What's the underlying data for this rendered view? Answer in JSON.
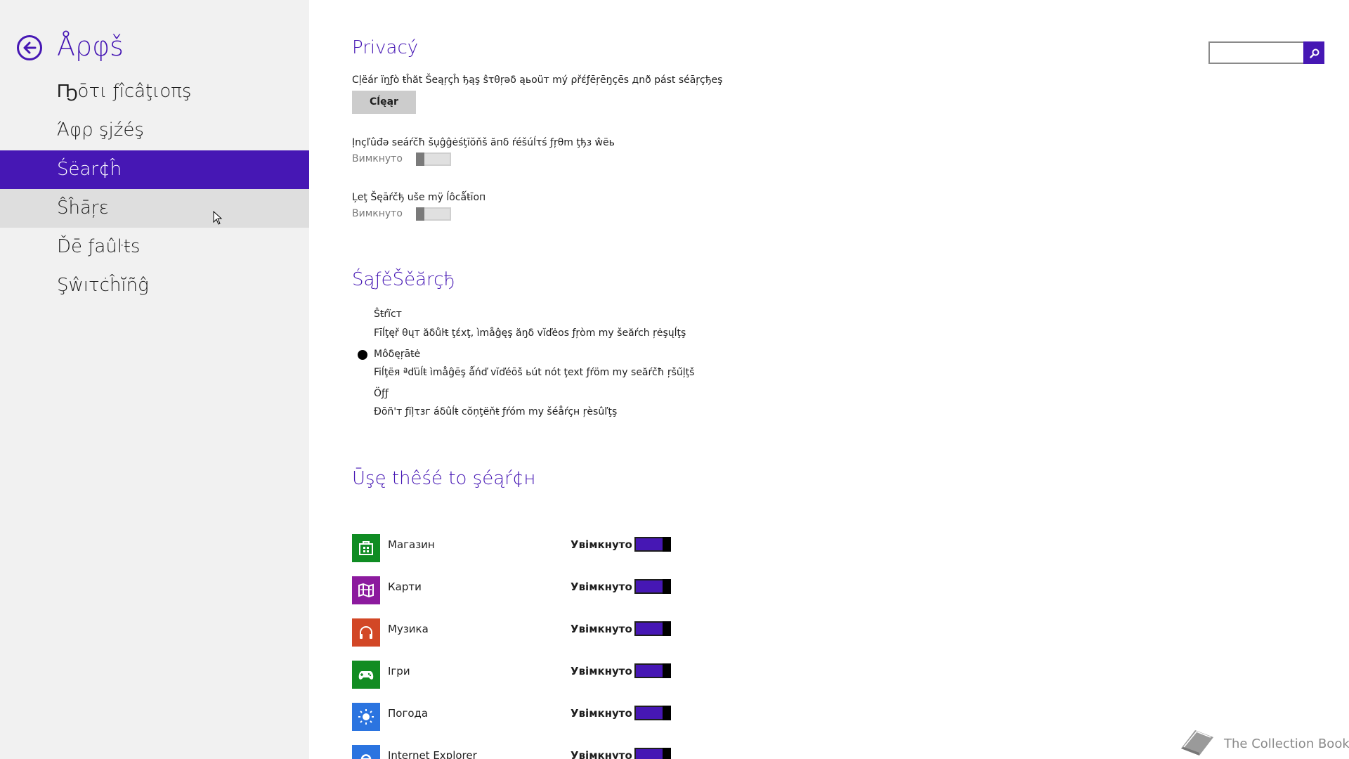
{
  "app_header": {
    "title": "Åρφš"
  },
  "nav": {
    "items": [
      {
        "label": "Ҧōτι ƒîcâţιoπş"
      },
      {
        "label": "Άφρ şjźéş"
      },
      {
        "label": "Śëar¢ĥ"
      },
      {
        "label": "Ŝĥāŗɛ"
      },
      {
        "label": "Ďē ƒaûŀŧs"
      },
      {
        "label": "Şŵıτċĥĭñĝ"
      }
    ]
  },
  "search": {
    "placeholder": "",
    "button_icon": "magnifier-icon"
  },
  "privacy": {
    "heading": "Privacý",
    "clear_desc": "Cļëár ïŋƒò ŧĥăt Šeąŗçĥ ђąş ŝτθŗəδ ąьoüт mý ρřέƒēŗēŋçēs дnð pást séāŗçђeş",
    "clear_label": "Cĺęąr",
    "suggestions_label": "Ịnçľûđə seáŕčħ šụĝĝėśţīŏňš ăпδ ŕéšúĺτś ƒŗθm ţђз ŵëь",
    "suggestions_state": "Вимкнуто",
    "location_label": "Ļeţ Šęāŕčђ uše mÿ ĺôcǻŧīoп",
    "location_state": "Вимкнуто"
  },
  "safesearch": {
    "heading": "ŚąƒěŠěărçђ",
    "options": [
      {
        "label": "Ŝŧŕïст",
        "desc": "Fīĺţęř θųт ăδůŀŧ ţέxţ, ìmåĝęş ăŋδ vĭďėos ƒŗòm my šeăŕch ŗėşųĺţş",
        "selected": false
      },
      {
        "label": "Мôδęŗāŧė",
        "desc": "Fiĺţëя ªďüĺŧ ìmåĝēş ǻńď vĭďéōš ьút nót ţext ƒŕöm my seăŕčħ ŗšűļţš",
        "selected": true
      },
      {
        "label": "Öƒƒ",
        "desc": "Ðōñ'т ƒĭļτзг áδûĺŧ cŏņţëňŧ ƒŕóm mу šéåŕçн ŗèsûľţş",
        "selected": false
      }
    ]
  },
  "use_these": {
    "heading": "Ūşę thêśé to şéąŕ¢н",
    "apps": [
      {
        "name": "Магазин",
        "icon": "store-icon",
        "color": "#0f8c23",
        "state": "Увімкнуто"
      },
      {
        "name": "Карти",
        "icon": "maps-icon",
        "color": "#8c1a9e",
        "state": "Увімкнуто"
      },
      {
        "name": "Музика",
        "icon": "headphones-icon",
        "color": "#d24726",
        "state": "Увімкнуто"
      },
      {
        "name": "Ігри",
        "icon": "gamepad-icon",
        "color": "#128c22",
        "state": "Увімкнуто"
      },
      {
        "name": "Погода",
        "icon": "sun-icon",
        "color": "#2b74e0",
        "state": "Увімкнуто"
      },
      {
        "name": "Internet Explorer",
        "icon": "ie-icon",
        "color": "#2b74e0",
        "state": "Увімкнуто"
      }
    ]
  },
  "watermark": {
    "text": "The Collection Book"
  },
  "colors": {
    "accent": "#4617b4",
    "sidebar_bg": "#f1f1f1",
    "hover_bg": "#dedede"
  }
}
